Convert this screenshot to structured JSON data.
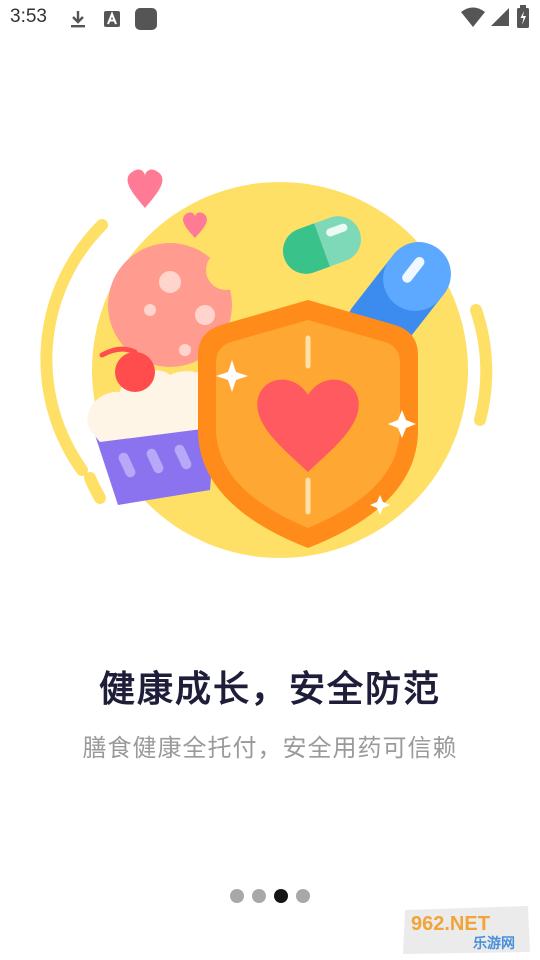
{
  "status_bar": {
    "time": "3:53",
    "left_icons": [
      "download-icon",
      "a-notification-icon",
      "app-notification-icon"
    ],
    "right_icons": [
      "wifi-icon",
      "cellular-signal-icon",
      "battery-icon"
    ]
  },
  "illustration": {
    "elements": [
      "yellow-circle",
      "heart-icon",
      "heart-icon",
      "capsule-icon",
      "capsule-icon",
      "cupcake-icon",
      "shield-heart-icon",
      "sparkle-icon"
    ],
    "colors": {
      "circle": "#FFE066",
      "shield_outer": "#FF8C1A",
      "shield_inner": "#FFA733",
      "heart": "#FF5A5F",
      "capsule_green": "#39C28A",
      "capsule_blue": "#3C8CF0",
      "cupcake_base": "#8B73F0",
      "cookie": "#FF9C8F"
    }
  },
  "onboarding": {
    "title": "健康成长，安全防范",
    "subtitle": "膳食健康全托付，安全用药可信赖"
  },
  "pager": {
    "total_pages": 4,
    "current_page": 3,
    "active_color": "#151515",
    "inactive_color": "#A8A8A8"
  },
  "watermark": {
    "top": "962.NET",
    "bottom": "乐游网"
  }
}
